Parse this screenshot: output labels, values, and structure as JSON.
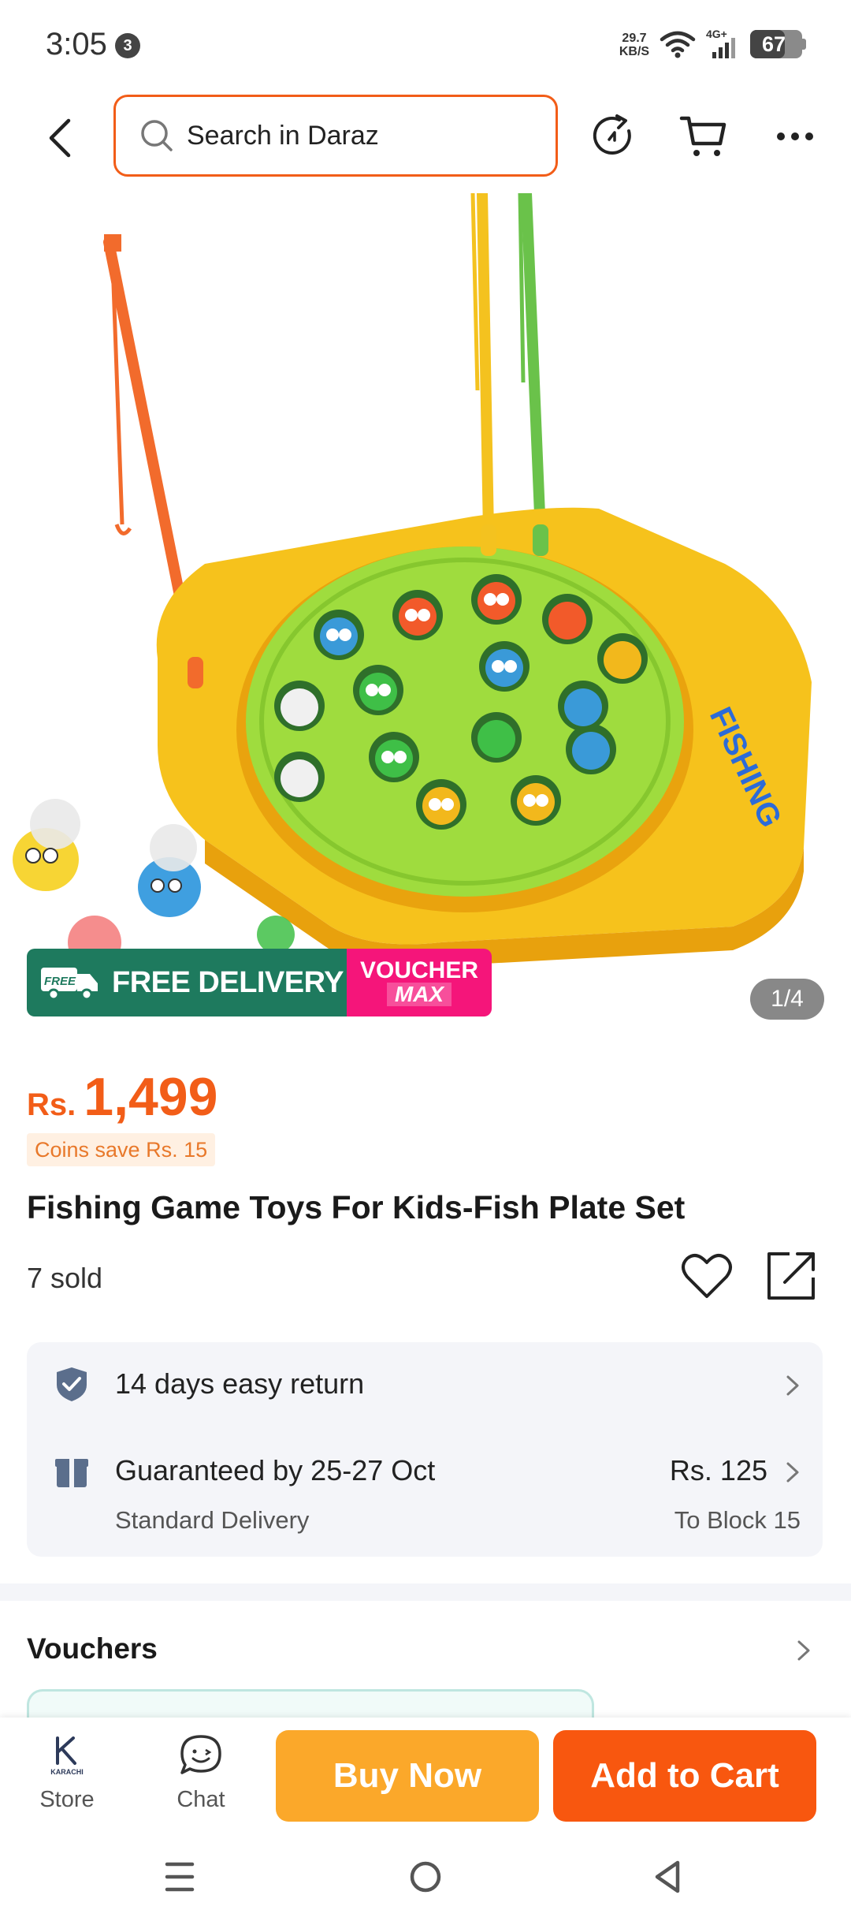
{
  "status_bar": {
    "time": "3:05",
    "notification_count": "3",
    "net_speed_value": "29.7",
    "net_speed_unit": "KB/S",
    "network_type": "4G+",
    "battery_level": 67,
    "battery_text": "67"
  },
  "header": {
    "search_placeholder": "Search in Daraz"
  },
  "hero": {
    "free_delivery_label": "FREE DELIVERY",
    "free_tag": "FREE",
    "voucher_line1": "VOUCHER",
    "voucher_line2": "MAX",
    "image_counter": "1/4",
    "sticker_text": "FISHING"
  },
  "product": {
    "currency": "Rs.",
    "price": "1,499",
    "coins_save": "Coins save Rs. 15",
    "title": "Fishing Game Toys For Kids-Fish Plate Set",
    "sold": "7 sold"
  },
  "delivery": {
    "return_policy": "14 days easy return",
    "guarantee": "Guaranteed by 25-27 Oct",
    "delivery_type": "Standard Delivery",
    "shipping_fee": "Rs. 125",
    "destination": "To Block 15"
  },
  "vouchers": {
    "title": "Vouchers"
  },
  "bottom_bar": {
    "store_label": "Store",
    "store_logo_text": "KARACHI",
    "chat_label": "Chat",
    "buy_now_label": "Buy Now",
    "add_to_cart_label": "Add to Cart"
  },
  "colors": {
    "accent": "#f25d18",
    "buy_now": "#fba82a",
    "add_to_cart": "#f8570f",
    "free_delivery": "#1e7a5e",
    "voucher_max": "#f5157a"
  }
}
